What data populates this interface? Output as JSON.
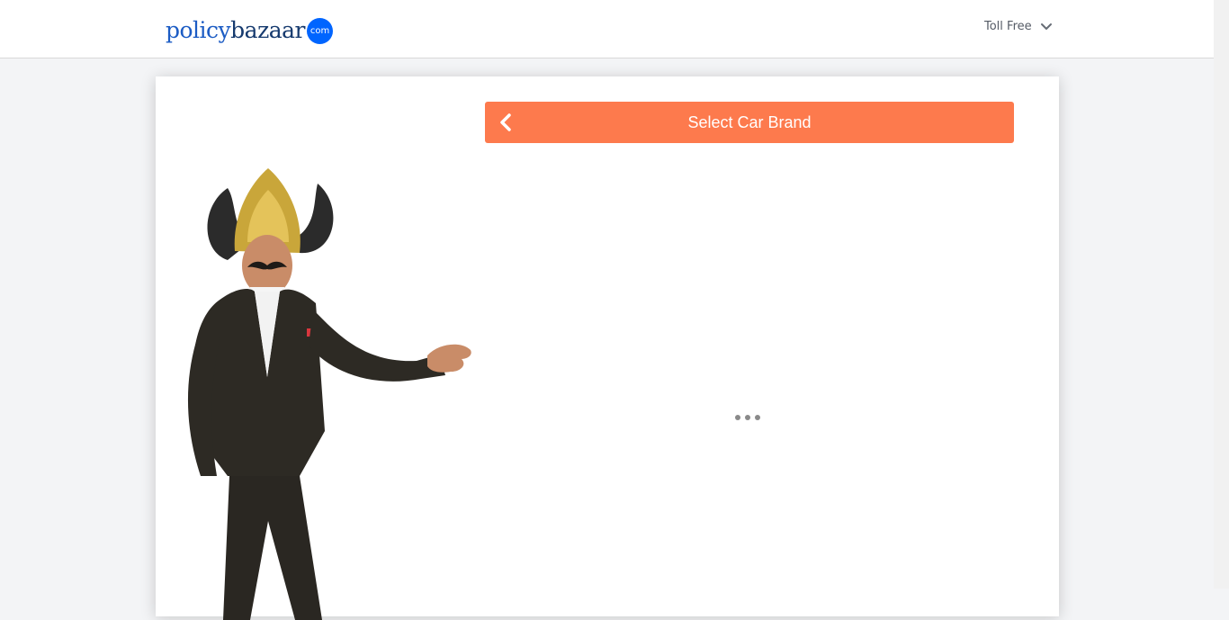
{
  "header": {
    "logo": {
      "part1": "policy",
      "part2": "bazaar",
      "badge": "com"
    },
    "toll_free_label": "Toll Free"
  },
  "card": {
    "title": "Select Car Brand"
  },
  "colors": {
    "accent": "#fd7a4d",
    "logo_blue": "#1c5cc4",
    "logo_navy": "#163a6e",
    "badge_blue": "#0065ff"
  },
  "icons": {
    "back": "chevron-left-icon",
    "toll_free_toggle": "chevron-down-icon",
    "loading": "loading-dots-icon"
  }
}
